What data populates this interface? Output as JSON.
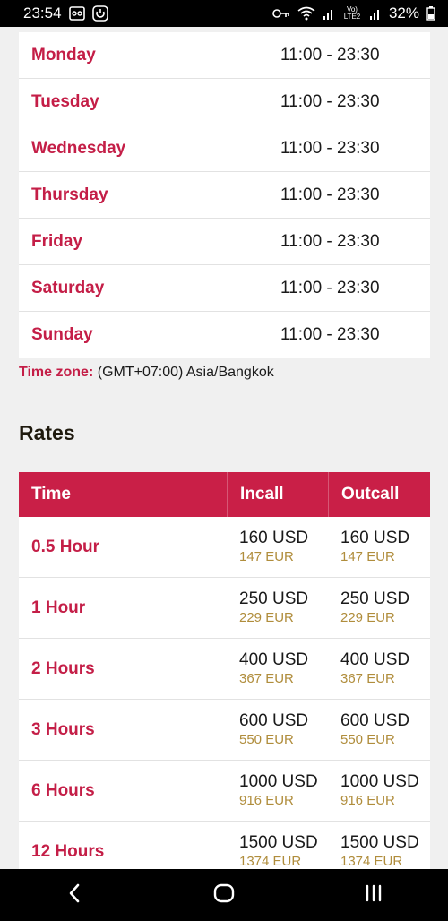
{
  "status_bar": {
    "time": "23:54",
    "network_label": "Vo) LTE2",
    "battery": "32%"
  },
  "hours": [
    {
      "day": "Monday",
      "time": "11:00 - 23:30"
    },
    {
      "day": "Tuesday",
      "time": "11:00 - 23:30"
    },
    {
      "day": "Wednesday",
      "time": "11:00 - 23:30"
    },
    {
      "day": "Thursday",
      "time": "11:00 - 23:30"
    },
    {
      "day": "Friday",
      "time": "11:00 - 23:30"
    },
    {
      "day": "Saturday",
      "time": "11:00 - 23:30"
    },
    {
      "day": "Sunday",
      "time": "11:00 - 23:30"
    }
  ],
  "timezone": {
    "label": "Time zone:",
    "value": "(GMT+07:00) Asia/Bangkok"
  },
  "rates": {
    "title": "Rates",
    "headers": {
      "time": "Time",
      "incall": "Incall",
      "outcall": "Outcall"
    },
    "rows": [
      {
        "time": "0.5 Hour",
        "incall_usd": "160 USD",
        "incall_eur": "147 EUR",
        "outcall_usd": "160 USD",
        "outcall_eur": "147 EUR"
      },
      {
        "time": "1 Hour",
        "incall_usd": "250 USD",
        "incall_eur": "229 EUR",
        "outcall_usd": "250 USD",
        "outcall_eur": "229 EUR"
      },
      {
        "time": "2 Hours",
        "incall_usd": "400 USD",
        "incall_eur": "367 EUR",
        "outcall_usd": "400 USD",
        "outcall_eur": "367 EUR"
      },
      {
        "time": "3 Hours",
        "incall_usd": "600 USD",
        "incall_eur": "550 EUR",
        "outcall_usd": "600 USD",
        "outcall_eur": "550 EUR"
      },
      {
        "time": "6 Hours",
        "incall_usd": "1000 USD",
        "incall_eur": "916 EUR",
        "outcall_usd": "1000 USD",
        "outcall_eur": "916 EUR"
      },
      {
        "time": "12 Hours",
        "incall_usd": "1500 USD",
        "incall_eur": "1374 EUR",
        "outcall_usd": "1500 USD",
        "outcall_eur": "1374 EUR"
      }
    ]
  },
  "colors": {
    "accent": "#c41e47",
    "header_bg": "#c91f47",
    "eur_text": "#b08d3c"
  },
  "icons": [
    "gallery-icon",
    "app-icon",
    "key-icon",
    "wifi-icon",
    "signal-icon",
    "battery-icon",
    "back-icon",
    "home-icon",
    "recent-apps-icon"
  ]
}
